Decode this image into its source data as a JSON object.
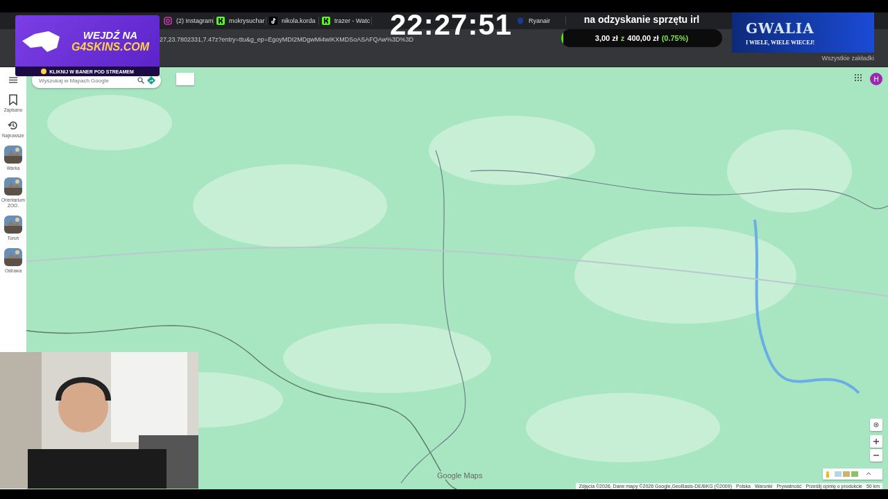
{
  "browser": {
    "tabs": [
      {
        "label": "(2) Instagram",
        "kind": "plain",
        "selected": false
      },
      {
        "label": "mokrysuchar",
        "kind": "kick",
        "selected": false
      },
      {
        "label": "nikola.korda",
        "kind": "tiktok",
        "selected": false
      },
      {
        "label": "trazer - Watc",
        "kind": "kick",
        "selected": false
      },
      {
        "label": "Ryanair",
        "kind": "shield",
        "selected": false
      }
    ],
    "address": "27,23.7802331,7.47z?entry=ttu&g_ep=EgoyMDI2MDgwMi4wIKXMDSoASAFQAw%3D%3D",
    "bookmarks": "Wszystkie zakładki"
  },
  "maps": {
    "search": {
      "placeholder": "Wyszukaj w Mapach Google"
    },
    "rail": [
      {
        "label": "Zapisano",
        "kind": "bookmark"
      },
      {
        "label": "Najnowsze",
        "kind": "history"
      },
      {
        "label": "Warka"
      },
      {
        "label": "Orientarium ZOO."
      },
      {
        "label": "Toruń"
      },
      {
        "label": "Ostrawa"
      }
    ],
    "avatar": "H",
    "brand": "Google Maps",
    "footer": [
      "Zdjęcia ©2026, Dane mapy ©2026 Google,GeoBasis-DE/BKG (©2009)",
      "Polska",
      "Warunki",
      "Prywatność",
      "Prześlij opinię o produkcie",
      "50 km"
    ]
  },
  "overlay": {
    "ad": {
      "line1": "WEJDŹ NA",
      "line2": "G4SKINS.COM",
      "footer": "KLIKNIJ W BANER POD STREAMEM"
    },
    "clock": "22:27:51",
    "goal": {
      "title": "na odzyskanie sprzętu irl",
      "raised": "3,00 zł",
      "separator": "z",
      "target": "400,00 zł",
      "percent": "(0.75%)",
      "level": 0.0075
    },
    "promo": {
      "logo": "GWALIA",
      "tagline": "I WIELE, WIELE WIECEJ!"
    }
  }
}
